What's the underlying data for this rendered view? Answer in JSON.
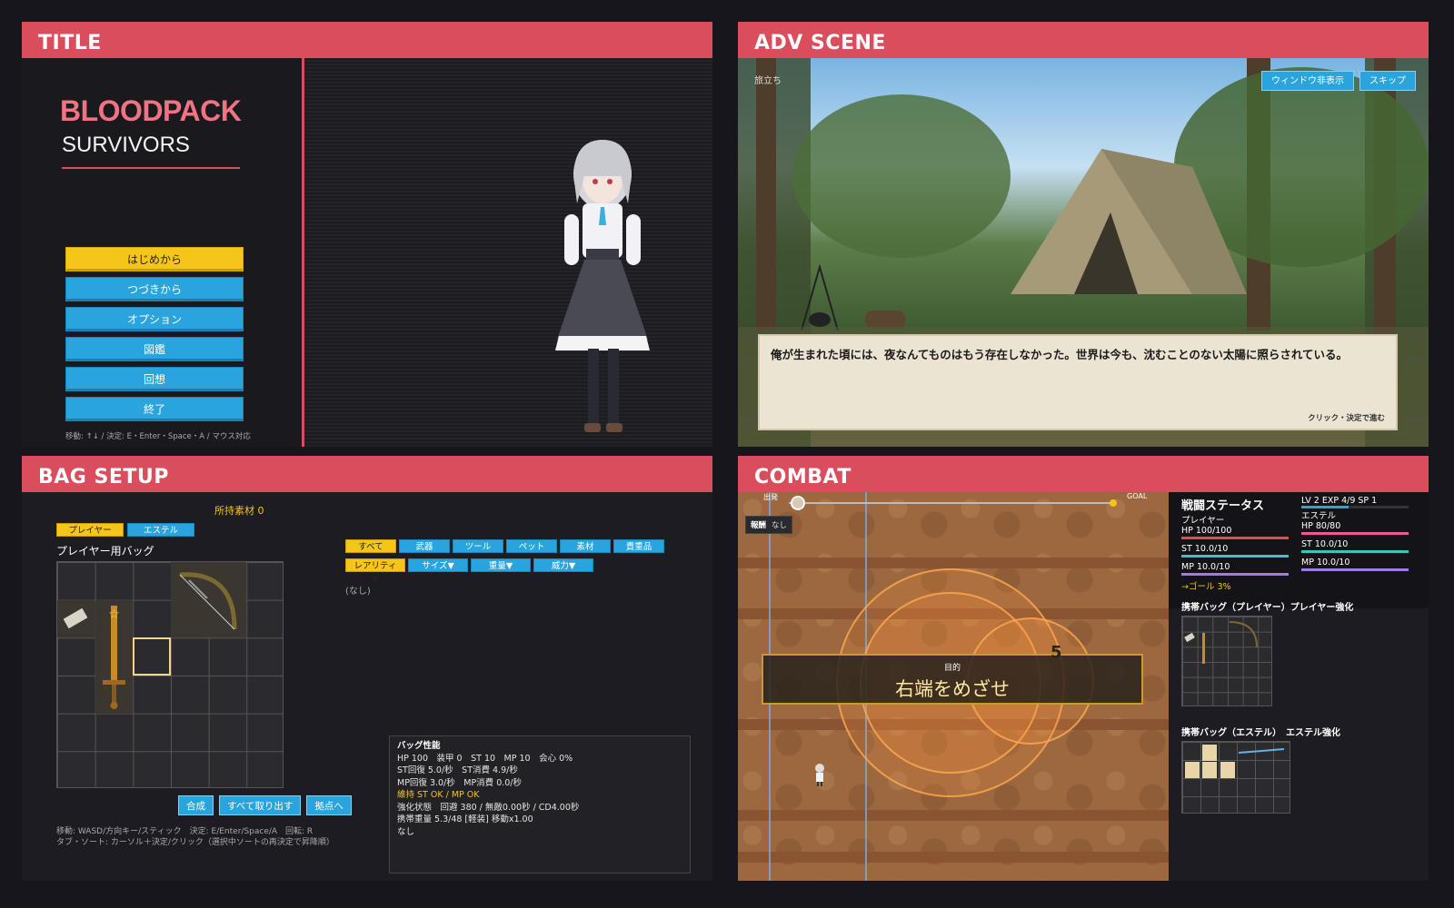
{
  "title_panel": {
    "header": "TITLE",
    "logo_main": "BLOODPACK",
    "logo_sub": "SURVIVORS",
    "menu": [
      "はじめから",
      "つづきから",
      "オプション",
      "図鑑",
      "回想",
      "終了"
    ],
    "hint": "移動: ↑↓ / 決定: E・Enter・Space・A / マウス対応"
  },
  "adv_panel": {
    "header": "ADV SCENE",
    "chapter": "旅立ち",
    "btn_hide": "ウィンドウ非表示",
    "btn_skip": "スキップ",
    "dialog": "俺が生まれた頃には、夜なんてものはもう存在しなかった。世界は今も、沈むことのない太陽に照らされている。",
    "continue_hint": "クリック・決定で進む"
  },
  "bag_panel": {
    "header": "BAG SETUP",
    "materials": "所持素材 0",
    "owner_tabs": [
      "プレイヤー",
      "エステル"
    ],
    "bag_label": "プレイヤー用バッグ",
    "filters_row1": [
      "すべて",
      "武器",
      "ツール",
      "ペット",
      "素材",
      "貴重品"
    ],
    "filters_row2": [
      "レアリティ▼",
      "サイズ▼",
      "重量▼",
      "威力▼"
    ],
    "list_empty": "(なし)",
    "actions": [
      "合成",
      "すべて取り出す",
      "拠点へ"
    ],
    "hint1": "移動: WASD/方向キー/スティック　決定: E/Enter/Space/A　回転: R",
    "hint2": "タブ・ソート: カーソル＋決定/クリック（選択中ソートの再決定で昇降順）",
    "stats": {
      "title": "バッグ性能",
      "line1": "HP 100　装甲 0　ST 10　MP 10　会心 0%",
      "line2": "ST回復 5.0/秒　ST消費 4.9/秒",
      "line3": "MP回復 3.0/秒　MP消費 0.0/秒",
      "line4": "維持 ST OK / MP OK",
      "line5": "強化状態　回避 380 / 無敵0.00秒 / CD4.00秒",
      "line6": "携帯重量 5.3/48 [軽装]  移動x1.00",
      "line7": "なし"
    }
  },
  "combat_panel": {
    "header": "COMBAT",
    "start": "出発",
    "goal": "GOAL",
    "reward_label": "報酬",
    "reward_value": "なし",
    "objective_small": "目的",
    "objective_big": "右端をめざせ",
    "damage": "5",
    "status": {
      "title": "戦闘ステータス",
      "player_name": "プレイヤー",
      "player_hp": "HP 100/100",
      "player_st": "ST 10.0/10",
      "player_mp": "MP 10.0/10",
      "level_line": "LV 2  EXP 4/9  SP 1",
      "estel_name": "エステル",
      "estel_hp": "HP 80/80",
      "estel_st": "ST 10.0/10",
      "estel_mp": "MP 10.0/10",
      "goal_pct": "→ゴール 3%",
      "exp_fill": 0.44
    },
    "carry_player": "携帯バッグ（プレイヤー）プレイヤー強化",
    "carry_estel": "携帯バッグ（エステル）　エステル強化"
  },
  "colors": {
    "accent_red": "#d94d5c",
    "button_blue": "#29a4dc",
    "button_yellow": "#f5c518",
    "hp_bar": "#e04b55",
    "st_bar": "#3ec2c2",
    "mp_bar": "#a07be0"
  }
}
